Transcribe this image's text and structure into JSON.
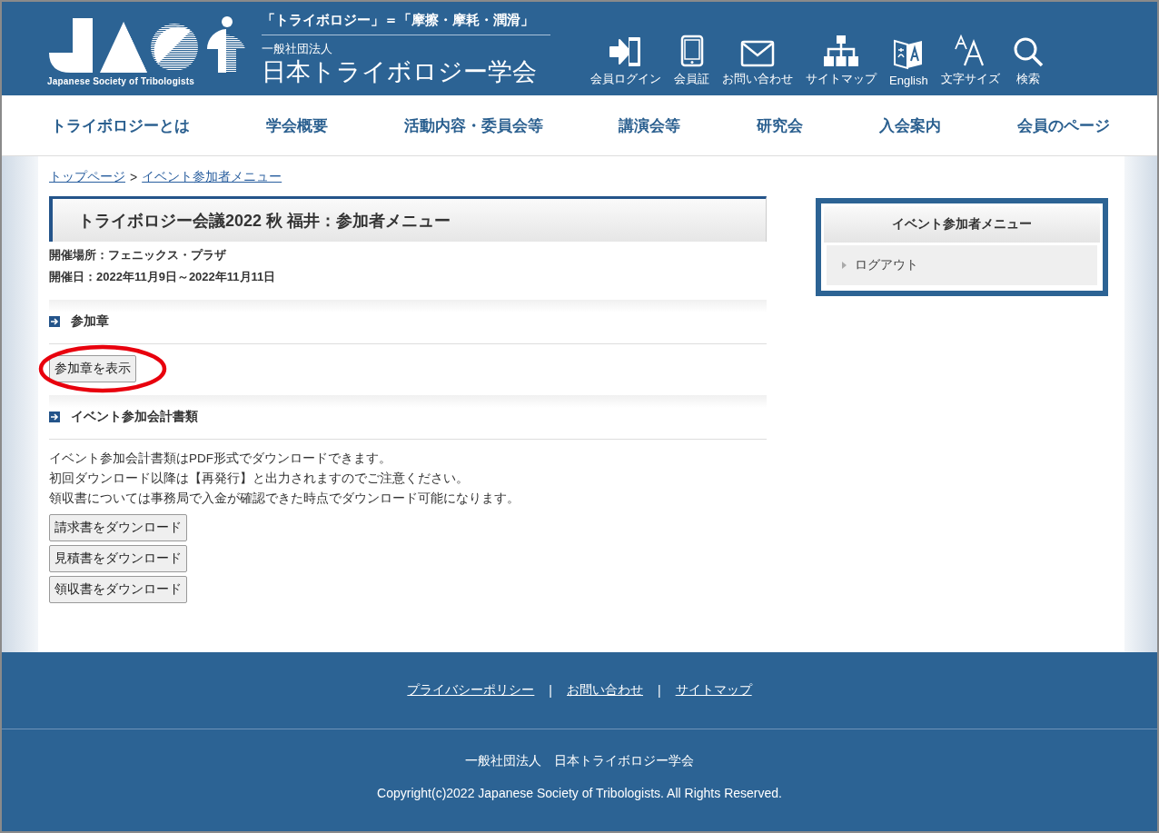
{
  "header": {
    "logo_caption": "Japanese Society of Tribologists",
    "tagline": "「トライボロジー」＝「摩擦・摩耗・潤滑」",
    "org_type": "一般社団法人",
    "org_name": "日本トライボロジー学会",
    "tools": [
      {
        "kind": "login",
        "label": "会員ログイン"
      },
      {
        "kind": "card",
        "label": "会員証"
      },
      {
        "kind": "mail",
        "label": "お問い合わせ"
      },
      {
        "kind": "sitemap",
        "label": "サイトマップ"
      },
      {
        "kind": "language",
        "label": "English"
      },
      {
        "kind": "fontsize",
        "label": "文字サイズ"
      },
      {
        "kind": "search",
        "label": "検索"
      }
    ]
  },
  "nav": [
    "トライボロジーとは",
    "学会概要",
    "活動内容・委員会等",
    "講演会等",
    "研究会",
    "入会案内",
    "会員のページ"
  ],
  "breadcrumb": [
    "トップページ",
    "イベント参加者メニュー"
  ],
  "breadcrumb_separator": ">",
  "page_title": "トライボロジー会議2022 秋 福井：参加者メニュー",
  "venue": "開催場所：フェニックス・プラザ",
  "dates": "開催日：2022年11月9日～2022年11月11日",
  "sections": [
    {
      "title": "参加章",
      "buttons": [
        "参加章を表示"
      ],
      "highlighted": true
    },
    {
      "title": "イベント参加会計書類",
      "lines": [
        "イベント参加会計書類はPDF形式でダウンロードできます。",
        "初回ダウンロード以降は【再発行】と出力されますのでご注意ください。",
        "領収書については事務局で入金が確認できた時点でダウンロード可能になります。"
      ],
      "buttons": [
        "請求書をダウンロード",
        "見積書をダウンロード",
        "領収書をダウンロード"
      ]
    }
  ],
  "sidebar": {
    "title": "イベント参加者メニュー",
    "items": [
      "ログアウト"
    ]
  },
  "footer": {
    "links": [
      "プライバシーポリシー",
      "お問い合わせ",
      "サイトマップ"
    ],
    "separator": "|",
    "org": "一般社団法人　日本トライボロジー学会",
    "copyright": "Copyright(c)2022 Japanese Society of Tribologists. All Rights Reserved."
  }
}
